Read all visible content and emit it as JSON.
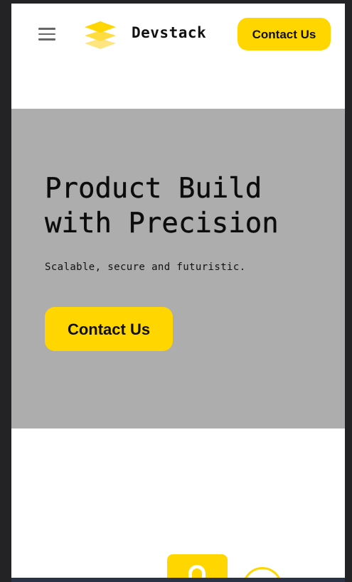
{
  "header": {
    "brand_name": "Devstack",
    "cta_label": "Contact Us",
    "menu_icon": "hamburger-menu-icon",
    "logo_icon": "stacked-layers-icon"
  },
  "hero": {
    "title": "Product Build with Precision",
    "subtitle": "Scalable, secure and futuristic.",
    "cta_label": "Contact Us"
  },
  "features": {
    "icons": [
      "lock-icon",
      "circle-icon"
    ]
  },
  "colors": {
    "accent": "#ffd600",
    "hero_background": "#adadad",
    "page_background": "#ffffff",
    "window_chrome": "#232325"
  }
}
